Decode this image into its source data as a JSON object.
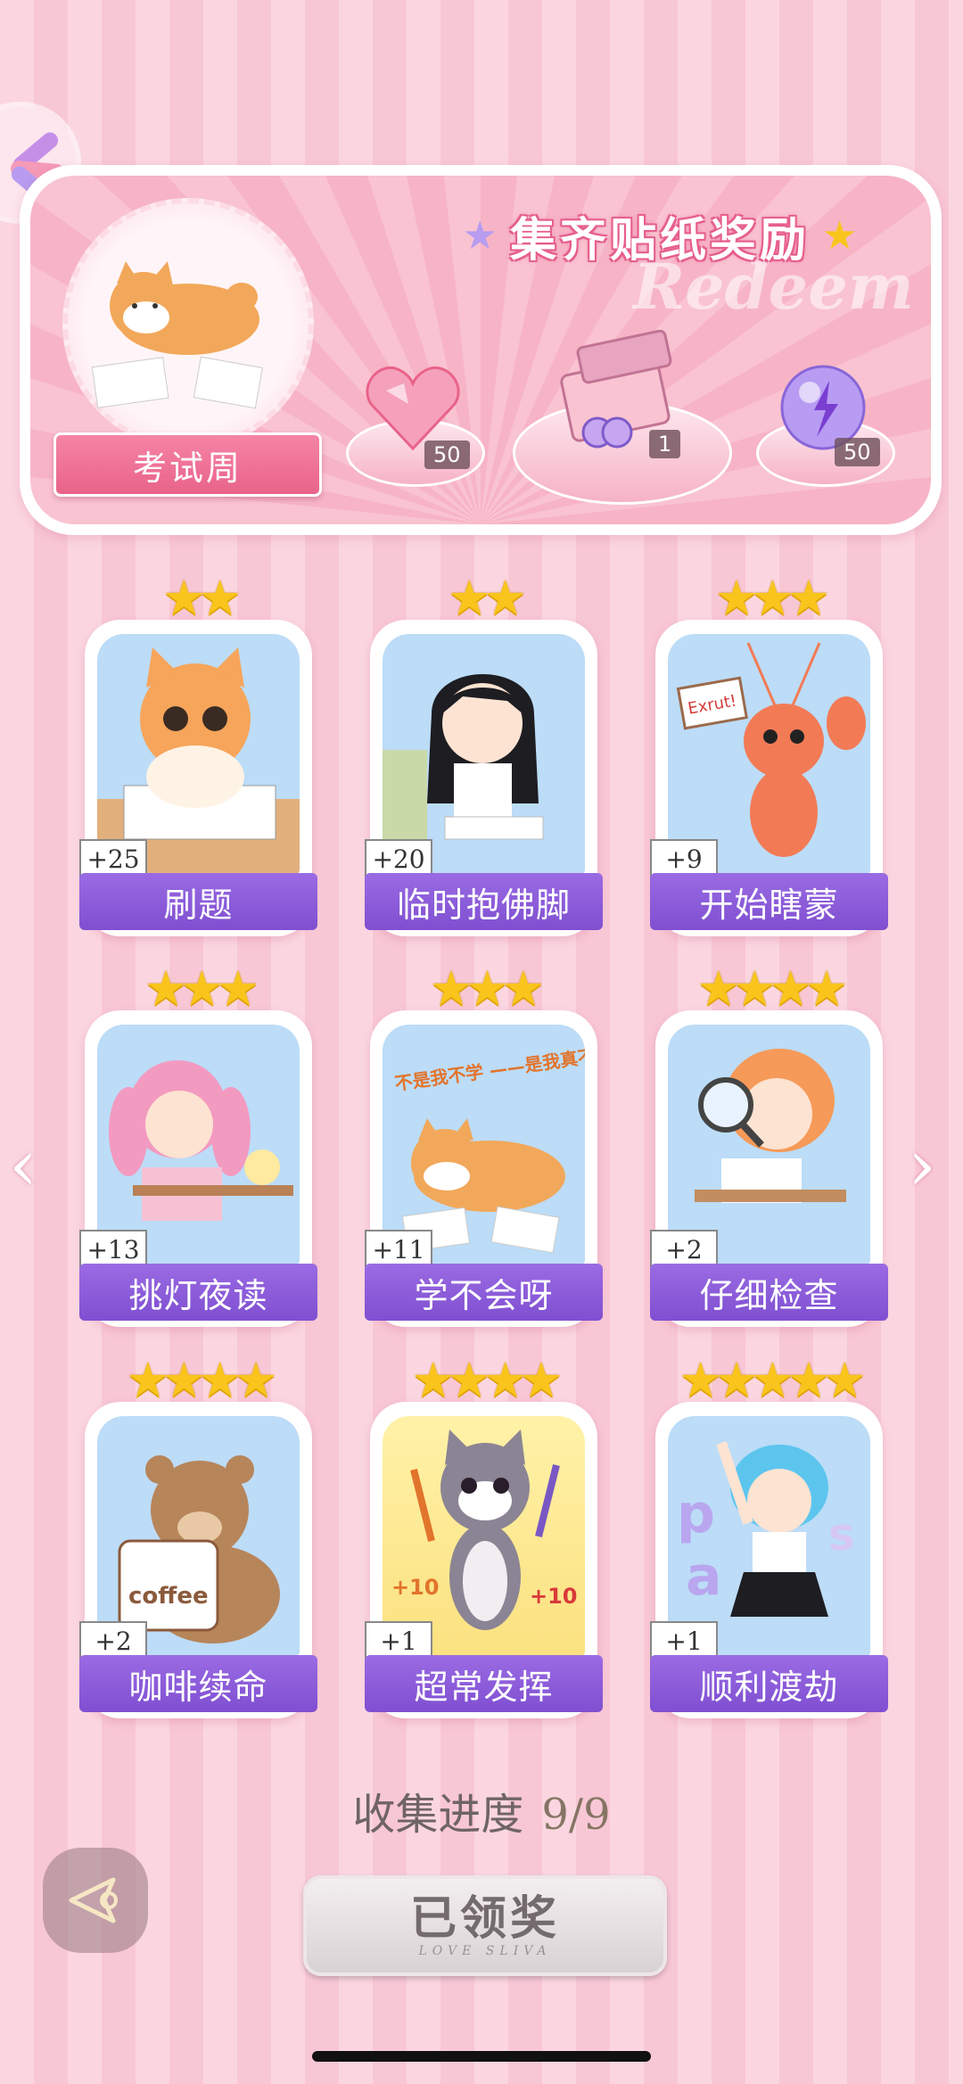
{
  "colors": {
    "accent_pink": "#e96389",
    "label_purple": "#8a5bd9",
    "star_gold": "#f9c51c"
  },
  "banner": {
    "title": "集齐贴纸奖励",
    "watermark": "Redeem",
    "theme_label": "考试周",
    "rewards": [
      {
        "icon": "heart-gem-icon",
        "count": "50"
      },
      {
        "icon": "gift-box-icon",
        "count": "1"
      },
      {
        "icon": "energy-orb-icon",
        "count": "50"
      }
    ]
  },
  "stickers": [
    {
      "label": "刷题",
      "count": "+25",
      "stars": 2,
      "art": "cat-studying-art"
    },
    {
      "label": "临时抱佛脚",
      "count": "+20",
      "stars": 2,
      "art": "girl-praying-art"
    },
    {
      "label": "开始瞎蒙",
      "count": "+9",
      "stars": 3,
      "art": "lobster-sign-art",
      "art_text": "Exrut!"
    },
    {
      "label": "挑灯夜读",
      "count": "+13",
      "stars": 3,
      "art": "girl-night-study-art"
    },
    {
      "label": "学不会呀",
      "count": "+11",
      "stars": 3,
      "art": "shiba-lying-art",
      "art_text": "不是我不学 ——是我真不会呀"
    },
    {
      "label": "仔细检查",
      "count": "+2",
      "stars": 4,
      "art": "girl-magnifier-art"
    },
    {
      "label": "咖啡续命",
      "count": "+2",
      "stars": 4,
      "art": "bear-coffee-art",
      "art_text": "coffee"
    },
    {
      "label": "超常发挥",
      "count": "+1",
      "stars": 4,
      "art": "cat-pencils-art",
      "art_text": "+10"
    },
    {
      "label": "顺利渡劫",
      "count": "+1",
      "stars": 5,
      "art": "girl-cheering-art"
    }
  ],
  "progress": {
    "label": "收集进度",
    "value": "9/9"
  },
  "claim_button": {
    "label": "已领奖",
    "sub": "LOVE SLIVA"
  }
}
